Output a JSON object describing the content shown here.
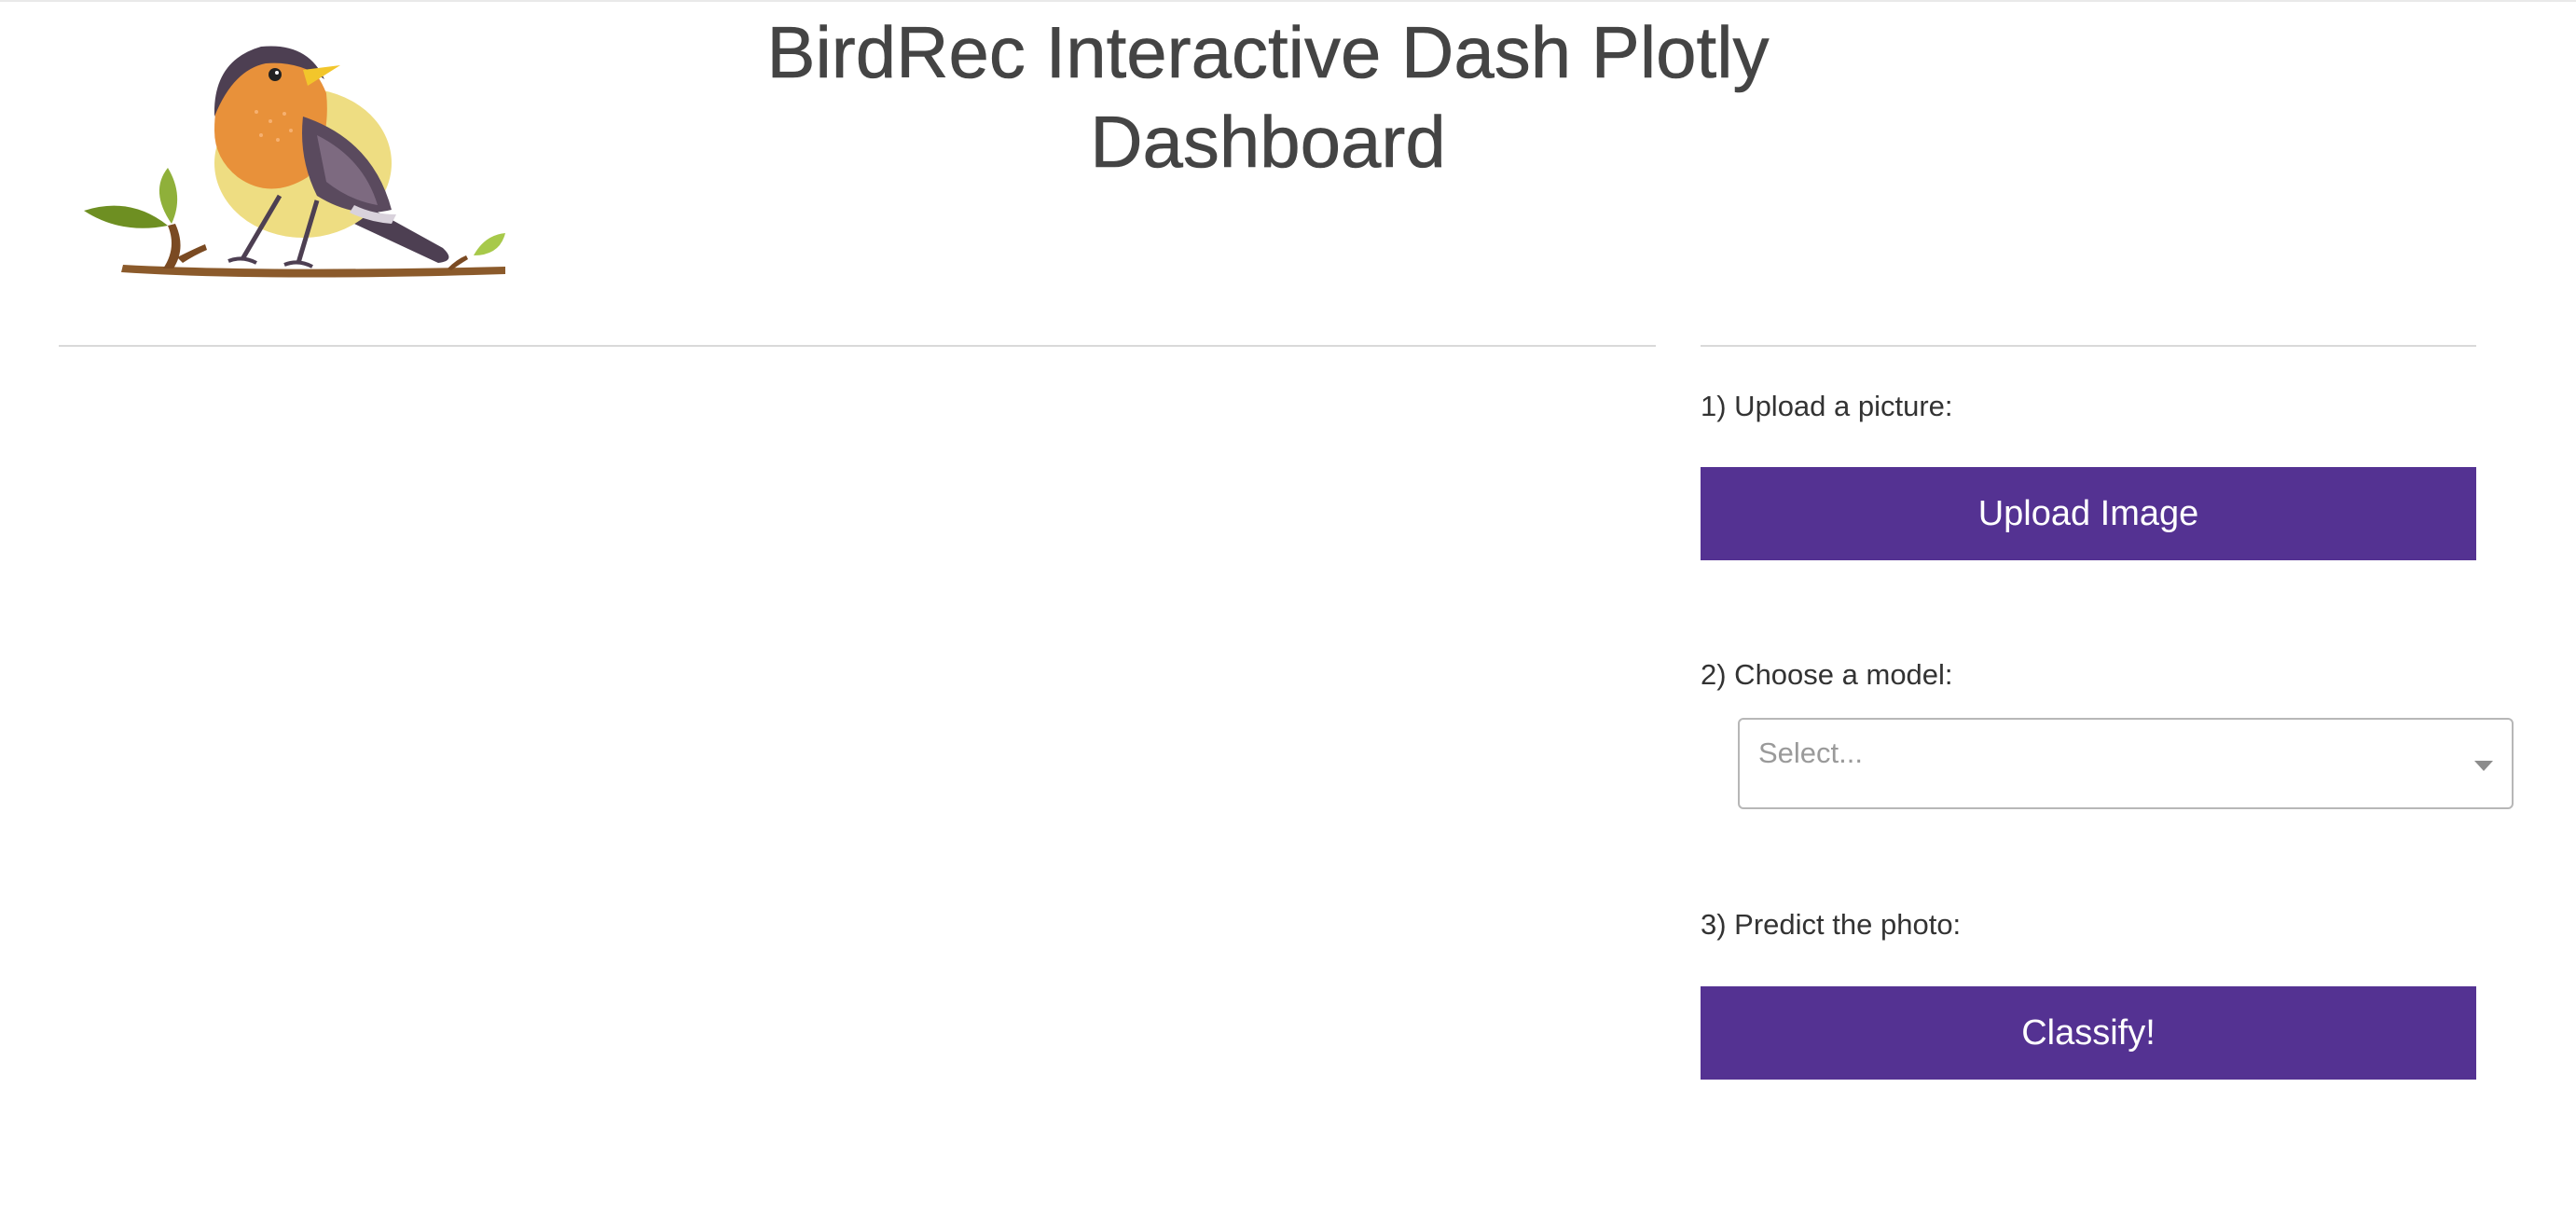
{
  "header": {
    "title": "BirdRec Interactive Dash Plotly Dashboard",
    "logo_icon": "robin-bird-on-branch-icon"
  },
  "controls": {
    "step1_label": "1) Upload a picture:",
    "upload_button_label": "Upload Image",
    "step2_label": "2) Choose a model:",
    "model_select": {
      "placeholder": "Select...",
      "selected_value": ""
    },
    "step3_label": "3) Predict the photo:",
    "classify_button_label": "Classify!"
  },
  "colors": {
    "accent": "#543292",
    "title_text": "#444444",
    "body_text": "#333333",
    "divider": "#d9d9d9",
    "bird_orange": "#e8913a",
    "bird_yellow": "#eedd82",
    "bird_wing": "#5a4a5e",
    "branch": "#8b5a2b",
    "leaf": "#7a9a2a"
  }
}
